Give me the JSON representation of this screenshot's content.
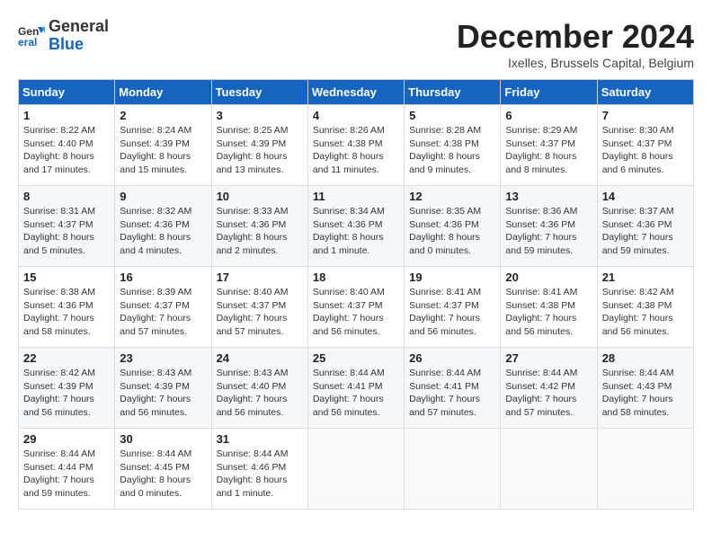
{
  "header": {
    "logo_general": "General",
    "logo_blue": "Blue",
    "month_title": "December 2024",
    "location": "Ixelles, Brussels Capital, Belgium"
  },
  "days_of_week": [
    "Sunday",
    "Monday",
    "Tuesday",
    "Wednesday",
    "Thursday",
    "Friday",
    "Saturday"
  ],
  "weeks": [
    [
      {
        "day": "1",
        "sunrise": "8:22 AM",
        "sunset": "4:40 PM",
        "daylight": "8 hours and 17 minutes."
      },
      {
        "day": "2",
        "sunrise": "8:24 AM",
        "sunset": "4:39 PM",
        "daylight": "8 hours and 15 minutes."
      },
      {
        "day": "3",
        "sunrise": "8:25 AM",
        "sunset": "4:39 PM",
        "daylight": "8 hours and 13 minutes."
      },
      {
        "day": "4",
        "sunrise": "8:26 AM",
        "sunset": "4:38 PM",
        "daylight": "8 hours and 11 minutes."
      },
      {
        "day": "5",
        "sunrise": "8:28 AM",
        "sunset": "4:38 PM",
        "daylight": "8 hours and 9 minutes."
      },
      {
        "day": "6",
        "sunrise": "8:29 AM",
        "sunset": "4:37 PM",
        "daylight": "8 hours and 8 minutes."
      },
      {
        "day": "7",
        "sunrise": "8:30 AM",
        "sunset": "4:37 PM",
        "daylight": "8 hours and 6 minutes."
      }
    ],
    [
      {
        "day": "8",
        "sunrise": "8:31 AM",
        "sunset": "4:37 PM",
        "daylight": "8 hours and 5 minutes."
      },
      {
        "day": "9",
        "sunrise": "8:32 AM",
        "sunset": "4:36 PM",
        "daylight": "8 hours and 4 minutes."
      },
      {
        "day": "10",
        "sunrise": "8:33 AM",
        "sunset": "4:36 PM",
        "daylight": "8 hours and 2 minutes."
      },
      {
        "day": "11",
        "sunrise": "8:34 AM",
        "sunset": "4:36 PM",
        "daylight": "8 hours and 1 minute."
      },
      {
        "day": "12",
        "sunrise": "8:35 AM",
        "sunset": "4:36 PM",
        "daylight": "8 hours and 0 minutes."
      },
      {
        "day": "13",
        "sunrise": "8:36 AM",
        "sunset": "4:36 PM",
        "daylight": "7 hours and 59 minutes."
      },
      {
        "day": "14",
        "sunrise": "8:37 AM",
        "sunset": "4:36 PM",
        "daylight": "7 hours and 59 minutes."
      }
    ],
    [
      {
        "day": "15",
        "sunrise": "8:38 AM",
        "sunset": "4:36 PM",
        "daylight": "7 hours and 58 minutes."
      },
      {
        "day": "16",
        "sunrise": "8:39 AM",
        "sunset": "4:37 PM",
        "daylight": "7 hours and 57 minutes."
      },
      {
        "day": "17",
        "sunrise": "8:40 AM",
        "sunset": "4:37 PM",
        "daylight": "7 hours and 57 minutes."
      },
      {
        "day": "18",
        "sunrise": "8:40 AM",
        "sunset": "4:37 PM",
        "daylight": "7 hours and 56 minutes."
      },
      {
        "day": "19",
        "sunrise": "8:41 AM",
        "sunset": "4:37 PM",
        "daylight": "7 hours and 56 minutes."
      },
      {
        "day": "20",
        "sunrise": "8:41 AM",
        "sunset": "4:38 PM",
        "daylight": "7 hours and 56 minutes."
      },
      {
        "day": "21",
        "sunrise": "8:42 AM",
        "sunset": "4:38 PM",
        "daylight": "7 hours and 56 minutes."
      }
    ],
    [
      {
        "day": "22",
        "sunrise": "8:42 AM",
        "sunset": "4:39 PM",
        "daylight": "7 hours and 56 minutes."
      },
      {
        "day": "23",
        "sunrise": "8:43 AM",
        "sunset": "4:39 PM",
        "daylight": "7 hours and 56 minutes."
      },
      {
        "day": "24",
        "sunrise": "8:43 AM",
        "sunset": "4:40 PM",
        "daylight": "7 hours and 56 minutes."
      },
      {
        "day": "25",
        "sunrise": "8:44 AM",
        "sunset": "4:41 PM",
        "daylight": "7 hours and 56 minutes."
      },
      {
        "day": "26",
        "sunrise": "8:44 AM",
        "sunset": "4:41 PM",
        "daylight": "7 hours and 57 minutes."
      },
      {
        "day": "27",
        "sunrise": "8:44 AM",
        "sunset": "4:42 PM",
        "daylight": "7 hours and 57 minutes."
      },
      {
        "day": "28",
        "sunrise": "8:44 AM",
        "sunset": "4:43 PM",
        "daylight": "7 hours and 58 minutes."
      }
    ],
    [
      {
        "day": "29",
        "sunrise": "8:44 AM",
        "sunset": "4:44 PM",
        "daylight": "7 hours and 59 minutes."
      },
      {
        "day": "30",
        "sunrise": "8:44 AM",
        "sunset": "4:45 PM",
        "daylight": "8 hours and 0 minutes."
      },
      {
        "day": "31",
        "sunrise": "8:44 AM",
        "sunset": "4:46 PM",
        "daylight": "8 hours and 1 minute."
      },
      null,
      null,
      null,
      null
    ]
  ],
  "labels": {
    "sunrise": "Sunrise: ",
    "sunset": "Sunset: ",
    "daylight": "Daylight: "
  }
}
